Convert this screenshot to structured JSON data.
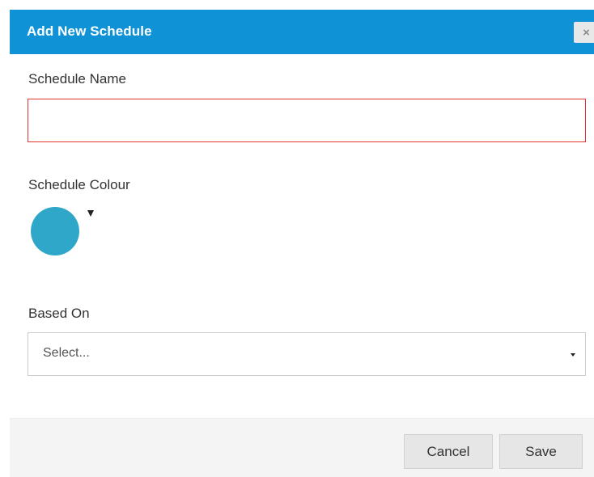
{
  "dialog": {
    "title": "Add New Schedule",
    "close_glyph": "×"
  },
  "form": {
    "name_label": "Schedule Name",
    "name_value": "",
    "name_error_color": "#e3342f",
    "colour_label": "Schedule Colour",
    "colour_value": "#2ea7c8",
    "based_on_label": "Based On",
    "based_on_value": "Select..."
  },
  "footer": {
    "cancel_label": "Cancel",
    "save_label": "Save"
  },
  "colors": {
    "header": "#0f93d6",
    "footer": "#f4f4f4"
  }
}
